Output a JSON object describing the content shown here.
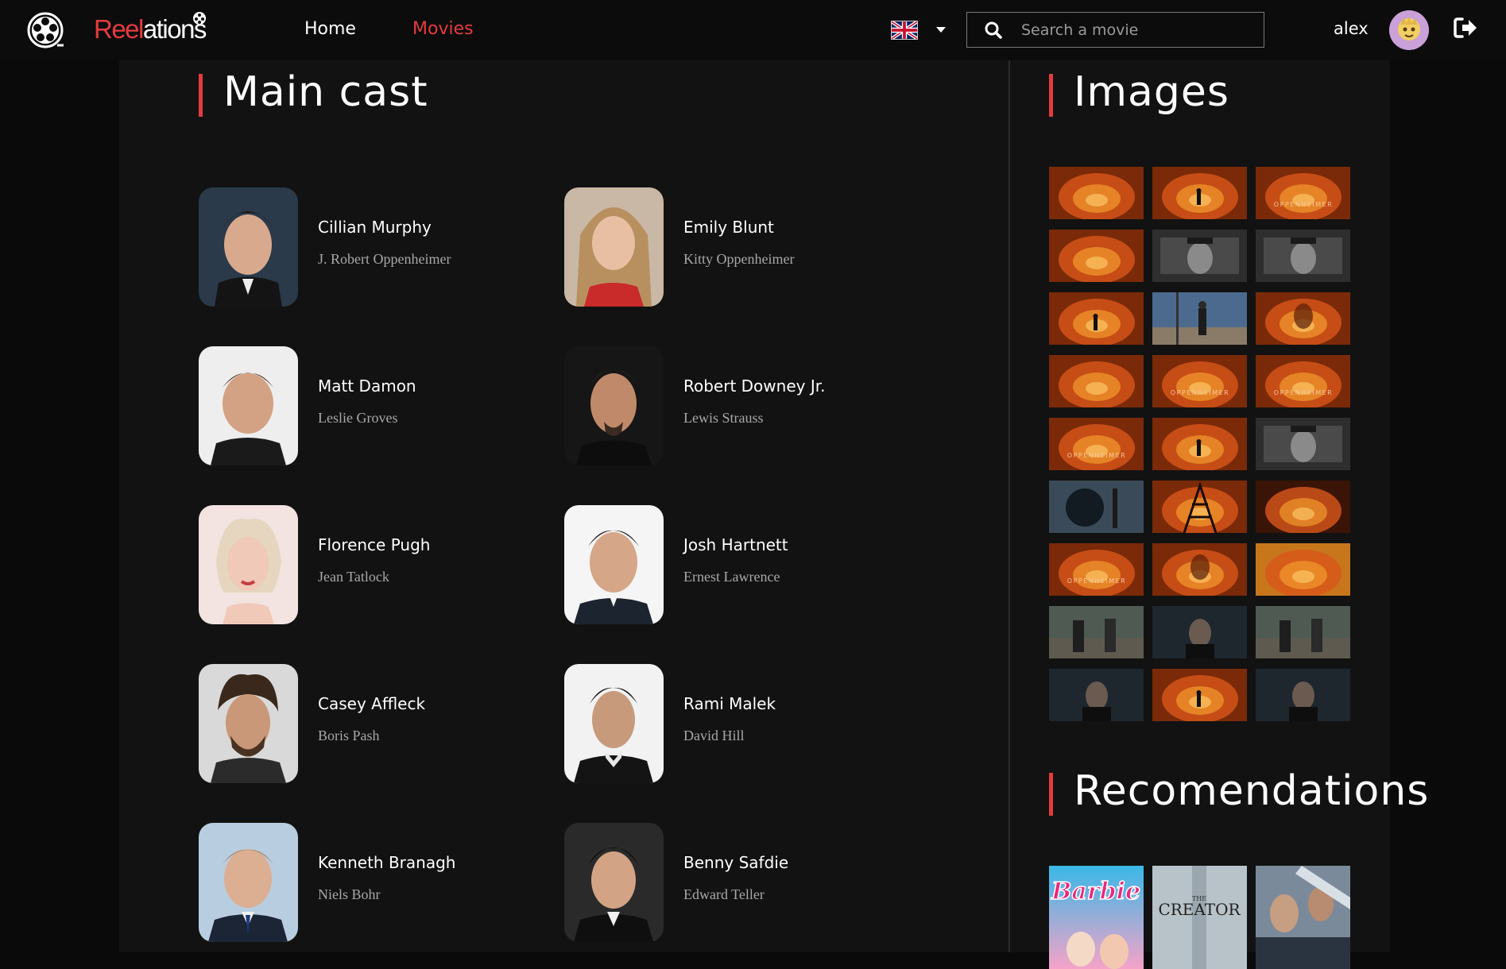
{
  "app": {
    "brand_reel": "Reel",
    "brand_ations": "ations"
  },
  "nav": {
    "home": "Home",
    "movies": "Movies"
  },
  "search": {
    "placeholder": "Search a movie"
  },
  "user": {
    "name": "alex"
  },
  "sections": {
    "cast_title": "Main cast",
    "images_title": "Images",
    "recommendations_title": "Recomendations"
  },
  "cast": [
    {
      "name": "Cillian Murphy",
      "role": "J. Robert Oppenheimer"
    },
    {
      "name": "Emily Blunt",
      "role": "Kitty Oppenheimer"
    },
    {
      "name": "Matt Damon",
      "role": "Leslie Groves"
    },
    {
      "name": "Robert Downey Jr.",
      "role": "Lewis Strauss"
    },
    {
      "name": "Florence Pugh",
      "role": "Jean Tatlock"
    },
    {
      "name": "Josh Hartnett",
      "role": "Ernest Lawrence"
    },
    {
      "name": "Casey Affleck",
      "role": "Boris Pash"
    },
    {
      "name": "Rami Malek",
      "role": "David Hill"
    },
    {
      "name": "Kenneth Branagh",
      "role": "Niels Bohr"
    },
    {
      "name": "Benny Safdie",
      "role": "Edward Teller"
    }
  ],
  "images": {
    "count": 27,
    "caption_oppenheimer": "OPPENHEIMER"
  },
  "recommendations": [
    {
      "title": "Barbie"
    },
    {
      "title": "CREATOR",
      "prefix": "THE"
    },
    {
      "title": ""
    }
  ],
  "colors": {
    "accent": "#e53b3e",
    "background": "#0a0a0a",
    "panel": "#121212",
    "muted_text": "#a8a8a8"
  },
  "icons": {
    "logo": "film-reel-icon",
    "language": "uk-flag-icon",
    "dropdown": "caret-down-icon",
    "search": "search-icon",
    "logout": "logout-icon"
  }
}
